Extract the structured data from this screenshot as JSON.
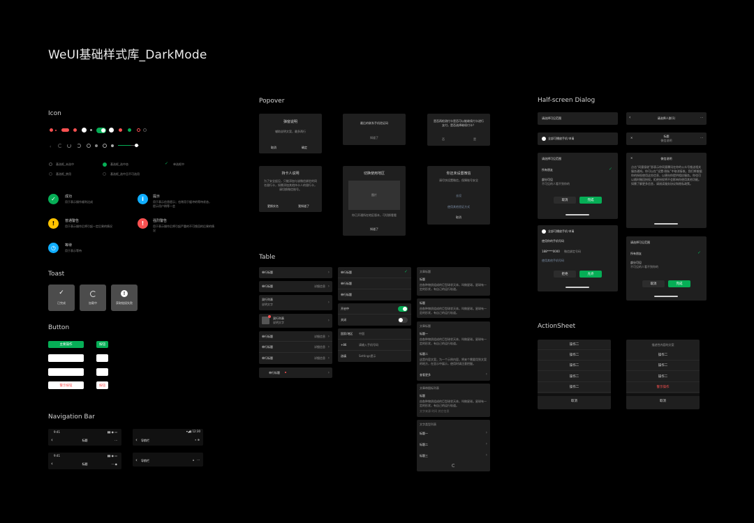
{
  "page_title": "WeUI基础样式库_DarkMode",
  "sections": {
    "icon": "Icon",
    "toast": "Toast",
    "button": "Button",
    "navbar": "Navigation Bar",
    "popover": "Popover",
    "table": "Table",
    "halfscreen": "Half-screen Dialog",
    "actionsheet": "ActionSheet"
  },
  "colors": {
    "bg": "#000000",
    "card": "#1f1f1f",
    "green": "#06ae56",
    "red": "#fa5151",
    "yellow": "#ffc300",
    "blue": "#10aeff",
    "link": "#7d90a9"
  },
  "icon_rows": {
    "radio1": "基选框_未选中",
    "radio2": "基选框_选中态",
    "check1": "单选框中",
    "radio3": "基选框_禁用",
    "radio4": "基选框_选中且不可选用"
  },
  "msg_icons": [
    {
      "title": "成功",
      "desc": "用于表示操作顺利达成",
      "icon": "success-icon"
    },
    {
      "title": "提示",
      "desc": "用于表示信息提示；也常用于缓冲的等待状态，提示用户稍等一会",
      "icon": "info-icon"
    },
    {
      "title": "普通警告",
      "desc": "用于表示操作后将引起一定后果的情况",
      "icon": "warn-icon"
    },
    {
      "title": "强烈警告",
      "desc": "用于表示操作后将引起严重的不可挽回的后果的情况",
      "icon": "strong-warn-icon"
    },
    {
      "title": "等待",
      "desc": "用于表示等待",
      "icon": "waiting-icon"
    }
  ],
  "toast": {
    "done": "已完成",
    "loading": "加载中",
    "error": "获取链接失败"
  },
  "buttons": {
    "primary": "主要操作",
    "small_primary": "按钮",
    "warn": "警示按钮",
    "small_warn": "按钮"
  },
  "navbar": {
    "time": "9:41",
    "title": "标题",
    "nav_title": "导航栏",
    "time2": "12:30"
  },
  "popover": {
    "p1_title": "弹窗说明",
    "p1_desc": "辅助说明文案，最多两行",
    "p1_cancel": "取消",
    "p1_ok": "确定",
    "p2_desc": "最后的联系手机验证码",
    "p2_ok": "知道了",
    "p3_desc": "是否再检测付卡是否可以能继续付卡进行支付，是否选择继续付卡？",
    "p3_cancel": "否",
    "p3_ok": "是",
    "p4_title": "持卡人说明",
    "p4_desc": "为了安全起见，只能添加与该微信绑定的同名银行卡，如需添加其他持卡人的银行卡，请切换微信账号。",
    "p4_left": "更换实名",
    "p4_right": "我知道了",
    "p5_title": "切换使用地区",
    "p5_img": "图片",
    "p5_desc": "你已开通所在地区版本，可切换看看",
    "p5_ok": "知道了",
    "p6_title": "你还未设置微信",
    "p6_desc": "请尽快设置微信，保障账号安全",
    "p6_a1": "去设",
    "p6_a2": "使用其他验证方式",
    "p6_a3": "取消"
  },
  "table": {
    "col1": [
      {
        "label": "单行标题",
        "value": ""
      },
      {
        "label": "单行标题",
        "value": "详细信息"
      },
      {
        "label": "双行列表",
        "sub": "说明文字",
        "value": ""
      },
      {
        "label": "双行列表",
        "sub": "说明文字",
        "value": ""
      }
    ],
    "col1b": [
      {
        "label": "单行标题",
        "value": "详细信息"
      },
      {
        "label": "单行标题",
        "value": "详细信息"
      },
      {
        "label": "单行标题",
        "value": "详细信息"
      }
    ],
    "col1c": "单行标题",
    "col2": [
      "单行标题",
      "单行标题",
      "单行标题"
    ],
    "col2_switch": [
      "开启中",
      "关闭"
    ],
    "col2_form": [
      {
        "label": "国家/地区",
        "value": "中国"
      },
      {
        "label": "+86",
        "value": "请输入手机号码"
      },
      {
        "label": "选填",
        "value": "Settings提示"
      }
    ],
    "col3": {
      "h1": "文章标题",
      "t1": "标题",
      "d1": "由各种物质组成的巨型球状天体，叫做星球。星球有一定的形状，有自己的运行轨道。",
      "t2": "标题",
      "d2": "由各种物质组成的巨型球状天体，叫做星球。星球有一定的形状，有自己的运行轨道。",
      "h3": "文章标题",
      "t3": "标题一",
      "d3": "由各种物质组成的巨型球状天体，叫做星球。星球有一定的形状，有自己的运行轨道。",
      "t4": "标题二",
      "d4": "这是内容文案，为一个示例内容，将来个需要用到文案的地方，在显示中展示，使用时请注意把握。",
      "more": "查看更多",
      "h5": "文章带图标列表",
      "t5": "标题",
      "d5": "由各种物质组成的巨型球状天体，叫做星球。星球有一定的形状，有自己的运行轨道。",
      "meta": "文字来源  时间  其它信息",
      "h6": "文字类型列表",
      "l1": "标题一",
      "l2": "标题二",
      "l3": "标题三"
    }
  },
  "halfscreen": {
    "h1": "请选择可见范围",
    "h2": "请选择人群(1)",
    "h3": "全部可播放手机 申请",
    "list1": [
      "所有朋友",
      "部分可见"
    ],
    "list1_sub": "不可见的人看不到你的",
    "cancel": "取消",
    "ok": "完成",
    "long_title": "标题",
    "long_sub": "微信说明",
    "long_body": "点击“同意接收”即表示你同意腾讯在你的公众号推送相关服务通知。你可以在“设置-隐私”中取消接收。我们将根据你的授权使用这些信息，以便向你提供相应服务。你也可以随时撤回授权。拒绝授权将不会影响你使用其他功能。如需了解更多信息，请阅读服务协议和隐私政策。",
    "phone_title": "全部可播放手机 申请",
    "phone_sub": "使用你的手机号码",
    "phone_num": "188****0000",
    "phone_tag": "微信绑定号码",
    "phone_link": "使用其他手机号码",
    "reject": "拒绝",
    "allow": "允许",
    "h4": "请选择可见范围",
    "list2": [
      "所有朋友",
      "部分可见"
    ],
    "list2_sub": "不可见的人看不到你的"
  },
  "actionsheet": {
    "items1": [
      "操作二",
      "操作二",
      "操作二",
      "操作二",
      "操作二"
    ],
    "cancel1": "取消",
    "head2": "描述性内容的文案",
    "items2": [
      "操作二",
      "操作二",
      "操作二",
      "操作二"
    ],
    "danger": "警示操作",
    "cancel2": "取消"
  }
}
